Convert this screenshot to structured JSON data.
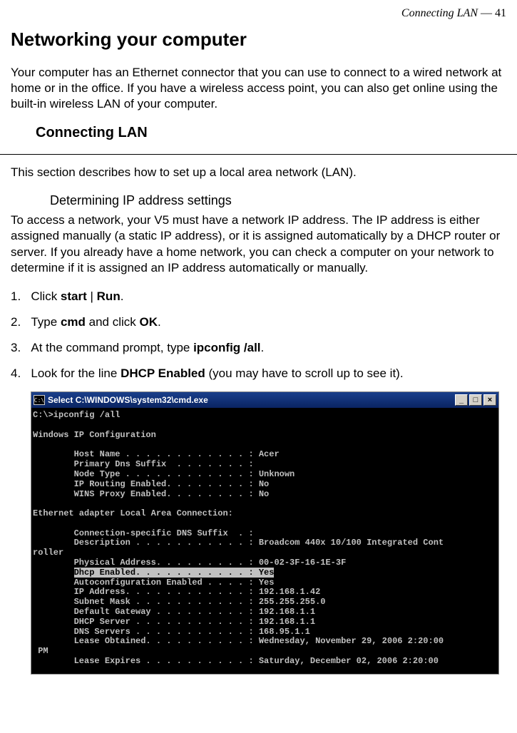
{
  "header": {
    "section_name": "Connecting LAN",
    "page_number": "41"
  },
  "headings": {
    "h1": "Networking your computer",
    "h2": "Connecting LAN",
    "h3": "Determining IP address settings"
  },
  "paragraphs": {
    "intro": "Your computer has an Ethernet connector that you can use to connect to a wired network at home or in the office. If you have a wireless access point, you can also get online using the built-in wireless LAN of your computer.",
    "lan_intro": "This section describes how to set up a local area network (LAN).",
    "ip_intro": "To access a network, your V5 must have a network IP address. The IP address is either assigned manually (a static IP address), or it is assigned automatically by a DHCP router or server. If you already have a home network, you can check a computer on your network to determine if it is assigned an IP address automatically or manually."
  },
  "list": {
    "step1": {
      "num": "1.",
      "pre": "Click ",
      "b1": "start",
      "mid": " | ",
      "b2": "Run",
      "post": "."
    },
    "step2": {
      "num": "2.",
      "pre": "Type ",
      "b1": "cmd",
      "mid": " and click ",
      "b2": "OK",
      "post": "."
    },
    "step3": {
      "num": "3.",
      "pre": "At the command prompt, type ",
      "b1": "ipconfig /all",
      "post": "."
    },
    "step4": {
      "num": "4.",
      "pre": "Look for the line ",
      "b1": "DHCP Enabled",
      "post": " (you may have to scroll up to see it)."
    }
  },
  "terminal": {
    "title_icon": "C:\\",
    "title": "Select C:\\WINDOWS\\system32\\cmd.exe",
    "buttons": {
      "min": "_",
      "max": "□",
      "close": "×"
    },
    "lines": {
      "l1": "C:\\>ipconfig /all",
      "l2": "",
      "l3": "Windows IP Configuration",
      "l4": "",
      "l5": "        Host Name . . . . . . . . . . . . : Acer",
      "l6": "        Primary Dns Suffix  . . . . . . . :",
      "l7": "        Node Type . . . . . . . . . . . . : Unknown",
      "l8": "        IP Routing Enabled. . . . . . . . : No",
      "l9": "        WINS Proxy Enabled. . . . . . . . : No",
      "l10": "",
      "l11": "Ethernet adapter Local Area Connection:",
      "l12": "",
      "l13": "        Connection-specific DNS Suffix  . :",
      "l14": "        Description . . . . . . . . . . . : Broadcom 440x 10/100 Integrated Cont",
      "l15": "roller",
      "l16": "        Physical Address. . . . . . . . . : 00-02-3F-16-1E-3F",
      "l17p": "        ",
      "l17h": "Dhcp Enabled. . . . . . . . . . . : Yes",
      "l18": "        Autoconfiguration Enabled . . . . : Yes",
      "l19": "        IP Address. . . . . . . . . . . . : 192.168.1.42",
      "l20": "        Subnet Mask . . . . . . . . . . . : 255.255.255.0",
      "l21": "        Default Gateway . . . . . . . . . : 192.168.1.1",
      "l22": "        DHCP Server . . . . . . . . . . . : 192.168.1.1",
      "l23": "        DNS Servers . . . . . . . . . . . : 168.95.1.1",
      "l24": "        Lease Obtained. . . . . . . . . . : Wednesday, November 29, 2006 2:20:00",
      "l25": " PM",
      "l26": "        Lease Expires . . . . . . . . . . : Saturday, December 02, 2006 2:20:00"
    }
  }
}
